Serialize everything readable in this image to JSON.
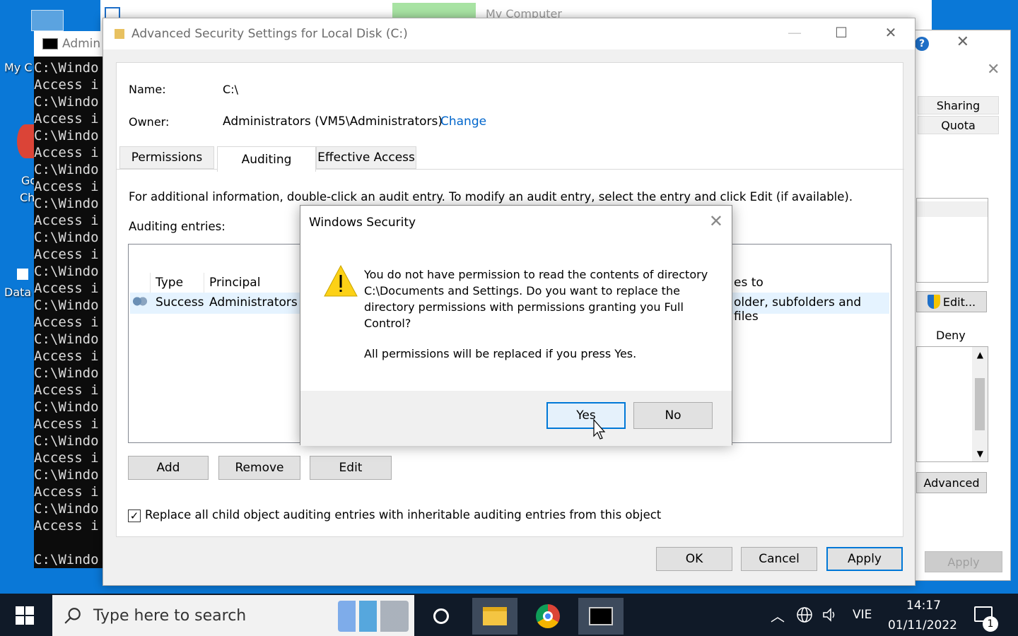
{
  "desktop": {
    "labels": [
      "My C",
      "Gc",
      "Ch",
      "Data"
    ]
  },
  "cmd": {
    "title": "Admin",
    "lines": [
      "C:\\Windo",
      "Access i",
      "C:\\Windo",
      "Access i",
      "C:\\Windo",
      "Access i",
      "C:\\Windo",
      "Access i",
      "C:\\Windo",
      "Access i",
      "C:\\Windo",
      "Access i",
      "C:\\Windo",
      "Access i",
      "C:\\Windo",
      "Access i",
      "C:\\Windo",
      "Access i",
      "C:\\Windo",
      "Access i",
      "C:\\Windo",
      "Access i",
      "C:\\Windo",
      "Access i",
      "C:\\Windo",
      "Access i",
      "C:\\Windo",
      "Access i",
      "",
      "C:\\Windo"
    ]
  },
  "mycomputer": {
    "title": "My Computer"
  },
  "properties": {
    "tabs": [
      "Sharing",
      "Quota"
    ],
    "edit_button": "Edit...",
    "deny_label": "Deny",
    "advanced_button": "Advanced",
    "apply_button": "Apply"
  },
  "advanced_security": {
    "title": "Advanced Security Settings for Local Disk (C:)",
    "name_label": "Name:",
    "name_value": "C:\\",
    "owner_label": "Owner:",
    "owner_value": "Administrators (VM5\\Administrators)",
    "change_link": "Change",
    "tabs": [
      "Permissions",
      "Auditing",
      "Effective Access"
    ],
    "info_text": "For additional information, double-click an audit entry. To modify an audit entry, select the entry and click Edit (if available).",
    "entries_label": "Auditing entries:",
    "columns": [
      "Type",
      "Principal",
      "es to"
    ],
    "row": {
      "type": "Success",
      "principal": "Administrators (V",
      "applies": "older, subfolders and files"
    },
    "add_button": "Add",
    "remove_button": "Remove",
    "edit_button": "Edit",
    "replace_checkbox_label": "Replace all child object auditing entries with inheritable auditing entries from this object",
    "ok_button": "OK",
    "cancel_button": "Cancel",
    "apply_button": "Apply"
  },
  "security_dialog": {
    "title": "Windows Security",
    "message": "You do not have permission to read the contents of directory C:\\Documents and Settings. Do you want to replace the directory permissions with permissions granting you Full Control?",
    "note": "All permissions will be replaced if you press Yes.",
    "yes_button": "Yes",
    "no_button": "No"
  },
  "taskbar": {
    "search_placeholder": "Type here to search",
    "language": "VIE",
    "time": "14:17",
    "date": "01/11/2022",
    "notification_count": "1"
  }
}
